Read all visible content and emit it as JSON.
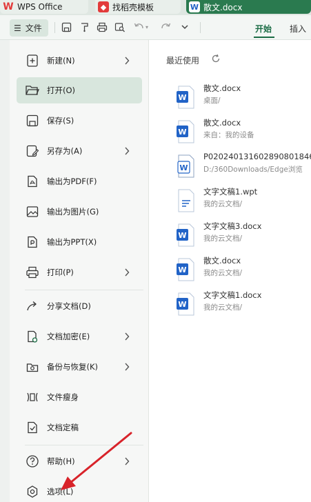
{
  "tabs": {
    "wps": "WPS Office",
    "find": "找稻壳模板",
    "doc": "散文.docx"
  },
  "toolbar": {
    "file_label": "文件",
    "start_tab": "开始",
    "insert_tab": "插入"
  },
  "menu": {
    "items": [
      {
        "label": "新建(N)"
      },
      {
        "label": "打开(O)"
      },
      {
        "label": "保存(S)"
      },
      {
        "label": "另存为(A)"
      },
      {
        "label": "输出为PDF(F)"
      },
      {
        "label": "输出为图片(G)"
      },
      {
        "label": "输出为PPT(X)"
      },
      {
        "label": "打印(P)"
      },
      {
        "label": "分享文档(D)"
      },
      {
        "label": "文档加密(E)"
      },
      {
        "label": "备份与恢复(K)"
      },
      {
        "label": "文件瘦身"
      },
      {
        "label": "文档定稿"
      },
      {
        "label": "帮助(H)"
      },
      {
        "label": "选项(L)"
      }
    ]
  },
  "recent": {
    "title": "最近使用",
    "files": [
      {
        "name": "散文.docx",
        "path": "桌面/",
        "type": "docx"
      },
      {
        "name": "散文.docx",
        "path": "来自：我的设备",
        "type": "docx"
      },
      {
        "name": "P020240131602890801846.",
        "path": "D:/360Downloads/Edge浏览",
        "type": "doc"
      },
      {
        "name": "文字文稿1.wpt",
        "path": "我的云文档/",
        "type": "wpt"
      },
      {
        "name": "文字文稿3.docx",
        "path": "我的云文档/",
        "type": "docx"
      },
      {
        "name": "散文.docx",
        "path": "我的云文档/",
        "type": "docx"
      },
      {
        "name": "文字文稿1.docx",
        "path": "我的云文档/",
        "type": "docx"
      }
    ]
  },
  "colors": {
    "accent": "#1a6b44",
    "active_tab": "#2a7a4f",
    "word_blue": "#2163c7",
    "annotation_red": "#d8232a"
  }
}
